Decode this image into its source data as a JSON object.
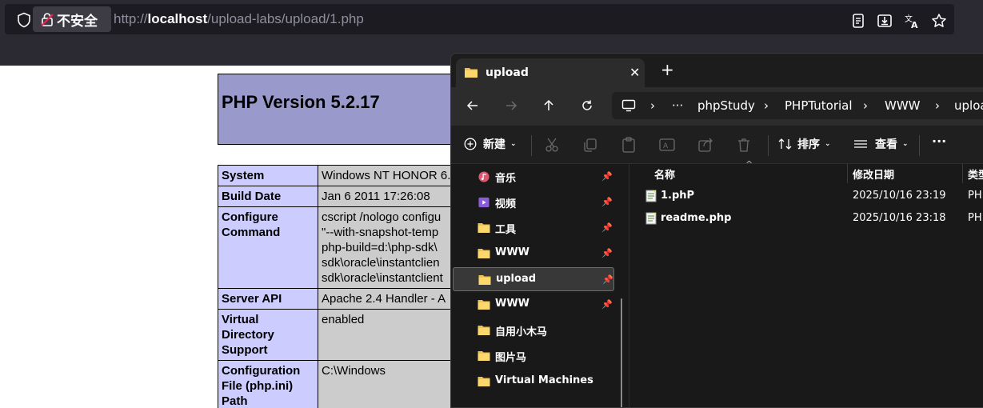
{
  "browser": {
    "insecure_label": "不安全",
    "url_prefix": "http://",
    "url_host": "localhost",
    "url_path": "/upload-labs/upload/1.php"
  },
  "php": {
    "title": "PHP Version 5.2.17",
    "rows": [
      {
        "key": "System",
        "value": "Windows NT HONOR 6."
      },
      {
        "key": "Build Date",
        "value": "Jan 6 2011 17:26:08"
      },
      {
        "key": "Configure Command",
        "value": "cscript /nologo configu\n\"--with-snapshot-temp\nphp-build=d:\\php-sdk\\\nsdk\\oracle\\instantclien\nsdk\\oracle\\instantclient"
      },
      {
        "key": "Server API",
        "value": "Apache 2.4 Handler - A"
      },
      {
        "key": "Virtual Directory Support",
        "value": "enabled"
      },
      {
        "key": "Configuration File (php.ini) Path",
        "value": "C:\\Windows"
      }
    ]
  },
  "explorer": {
    "tab_label": "upload",
    "breadcrumb": [
      "phpStudy",
      "PHPTutorial",
      "WWW",
      "uploa"
    ],
    "toolbar": {
      "new": "新建",
      "sort": "排序",
      "view": "查看"
    },
    "nav_items": [
      {
        "label": "音乐",
        "icon": "music-icon",
        "pinned": true
      },
      {
        "label": "视频",
        "icon": "video-icon",
        "pinned": true
      },
      {
        "label": "工具",
        "icon": "folder-icon",
        "pinned": true
      },
      {
        "label": "WWW",
        "icon": "folder-icon",
        "pinned": true
      },
      {
        "label": "upload",
        "icon": "folder-icon",
        "pinned": true,
        "selected": true
      },
      {
        "label": "WWW",
        "icon": "folder-icon",
        "pinned": true
      },
      {
        "label": "自用小木马",
        "icon": "folder-icon",
        "pinned": false
      },
      {
        "label": "图片马",
        "icon": "folder-icon",
        "pinned": false
      },
      {
        "label": "Virtual Machines",
        "icon": "folder-icon",
        "pinned": false
      }
    ],
    "columns": {
      "name": "名称",
      "modified": "修改日期",
      "type": "类型"
    },
    "files": [
      {
        "name": "1.phP",
        "modified": "2025/10/16 23:19",
        "type": "PH"
      },
      {
        "name": "readme.php",
        "modified": "2025/10/16 23:18",
        "type": "PH"
      }
    ]
  },
  "colors": {
    "php_header": "#9999cc",
    "php_key": "#ccccff",
    "php_value": "#cccccc",
    "folder": "#f2c04c"
  }
}
